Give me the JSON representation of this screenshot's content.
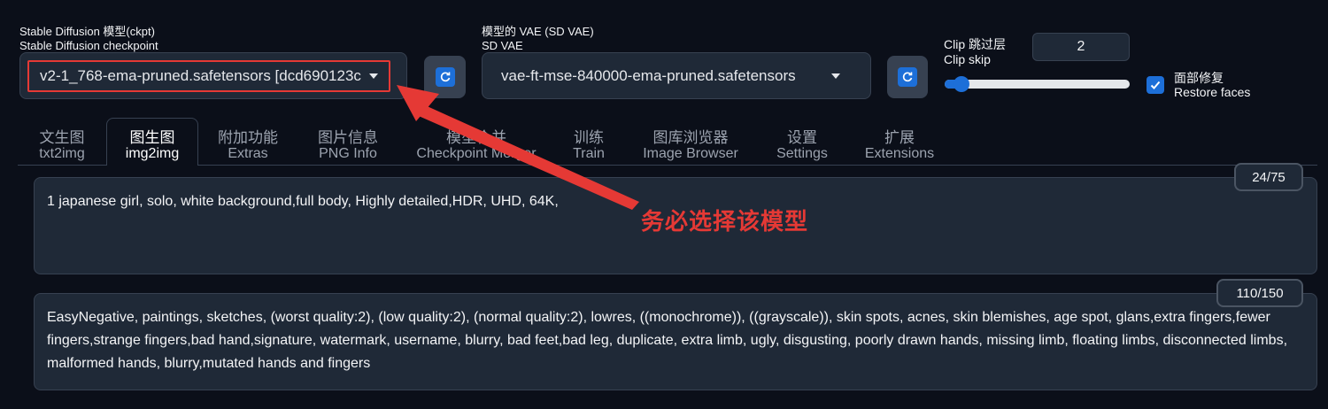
{
  "checkpoint": {
    "label_line1": "Stable Diffusion 模型(ckpt)",
    "label_line2": "Stable Diffusion checkpoint",
    "value": "v2-1_768-ema-pruned.safetensors [dcd690123c"
  },
  "vae": {
    "label_line1": "模型的 VAE (SD VAE)",
    "label_line2": "SD VAE",
    "value": "vae-ft-mse-840000-ema-pruned.safetensors"
  },
  "clip_skip": {
    "label_line1": "Clip 跳过层",
    "label_line2": "Clip skip",
    "value": "2",
    "slider_fraction": 0.09
  },
  "restore_faces": {
    "label_line1": "面部修复",
    "label_line2": "Restore faces",
    "checked": true
  },
  "tabs": [
    {
      "zh": "文生图",
      "en": "txt2img"
    },
    {
      "zh": "图生图",
      "en": "img2img"
    },
    {
      "zh": "附加功能",
      "en": "Extras"
    },
    {
      "zh": "图片信息",
      "en": "PNG Info"
    },
    {
      "zh": "模型合并",
      "en": "Checkpoint Merger"
    },
    {
      "zh": "训练",
      "en": "Train"
    },
    {
      "zh": "图库浏览器",
      "en": "Image Browser"
    },
    {
      "zh": "设置",
      "en": "Settings"
    },
    {
      "zh": "扩展",
      "en": "Extensions"
    }
  ],
  "active_tab": 1,
  "prompt": {
    "text": "1 japanese girl, solo, white background,full body, Highly detailed,HDR, UHD, 64K,",
    "counter": "24/75"
  },
  "negative_prompt": {
    "text": "EasyNegative, paintings, sketches, (worst quality:2), (low quality:2), (normal quality:2), lowres, ((monochrome)), ((grayscale)), skin spots, acnes, skin blemishes, age spot, glans,extra fingers,fewer fingers,strange fingers,bad hand,signature, watermark, username, blurry, bad feet,bad leg, duplicate, extra limb, ugly, disgusting, poorly drawn hands, missing limb, floating limbs, disconnected limbs, malformed hands, blurry,mutated hands and fingers",
    "counter": "110/150"
  },
  "annotation": {
    "text": "务必选择该模型",
    "color": "#e53935"
  },
  "colors": {
    "accent": "#1d6fd8",
    "background": "#0b0f19"
  }
}
